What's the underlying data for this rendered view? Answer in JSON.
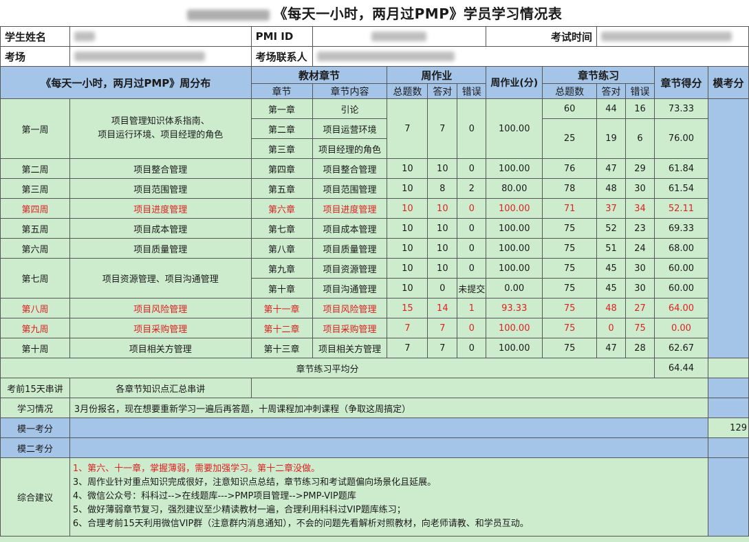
{
  "title": "《每天一小时，两月过PMP》学员学习情况表",
  "info": {
    "student_name_label": "学生姓名",
    "pmi_id_label": "PMI ID",
    "exam_time_label": "考试时间",
    "exam_site_label": "考场",
    "exam_contact_label": "考场联系人"
  },
  "headers": {
    "weekly": "《每天一小时，两月过PMP》周分布",
    "chapters": "教材章节",
    "chapter": "章节",
    "chapter_content": "章节内容",
    "homework": "周作业",
    "hw_total": "总题数",
    "hw_correct": "答对",
    "hw_wrong": "错误",
    "hw_score": "周作业(分)",
    "practice": "章节练习",
    "pr_total": "总题数",
    "pr_correct": "答对",
    "pr_wrong": "错误",
    "chapter_score": "章节得分",
    "mock_score": "模考分"
  },
  "weeks": [
    {
      "week": "第一周",
      "topic": "项目管理知识体系指南、\n项目运行环境、项目经理的角色"
    },
    {
      "week": "第二周",
      "topic": "项目整合管理"
    },
    {
      "week": "第三周",
      "topic": "项目范围管理"
    },
    {
      "week": "第四周",
      "topic": "项目进度管理"
    },
    {
      "week": "第五周",
      "topic": "项目成本管理"
    },
    {
      "week": "第六周",
      "topic": "项目质量管理"
    },
    {
      "week": "第七周",
      "topic": "项目资源管理、项目沟通管理"
    },
    {
      "week": "第八周",
      "topic": "项目风险管理"
    },
    {
      "week": "第九周",
      "topic": "项目采购管理"
    },
    {
      "week": "第十周",
      "topic": "项目相关方管理"
    }
  ],
  "chapters": [
    {
      "ch": "第一章",
      "content": "引论"
    },
    {
      "ch": "第二章",
      "content": "项目运营环境"
    },
    {
      "ch": "第三章",
      "content": "项目经理的角色"
    },
    {
      "ch": "第四章",
      "content": "项目整合管理"
    },
    {
      "ch": "第五章",
      "content": "项目范围管理"
    },
    {
      "ch": "第六章",
      "content": "项目进度管理"
    },
    {
      "ch": "第七章",
      "content": "项目成本管理"
    },
    {
      "ch": "第八章",
      "content": "项目质量管理"
    },
    {
      "ch": "第九章",
      "content": "项目资源管理"
    },
    {
      "ch": "第十章",
      "content": "项目沟通管理"
    },
    {
      "ch": "第十一章",
      "content": "项目风险管理"
    },
    {
      "ch": "第十二章",
      "content": "项目采购管理"
    },
    {
      "ch": "第十三章",
      "content": "项目相关方管理"
    }
  ],
  "homework": [
    {
      "total": "7",
      "correct": "7",
      "wrong": "0",
      "score": "100.00"
    },
    {
      "total": "10",
      "correct": "10",
      "wrong": "0",
      "score": "100.00"
    },
    {
      "total": "10",
      "correct": "8",
      "wrong": "2",
      "score": "80.00"
    },
    {
      "total": "10",
      "correct": "10",
      "wrong": "0",
      "score": "100.00"
    },
    {
      "total": "10",
      "correct": "10",
      "wrong": "0",
      "score": "100.00"
    },
    {
      "total": "10",
      "correct": "10",
      "wrong": "0",
      "score": "100.00"
    },
    {
      "total": "10",
      "correct": "10",
      "wrong": "0",
      "score": "100.00"
    },
    {
      "total": "10",
      "correct": "0",
      "wrong": "未提交",
      "score": "0.00"
    },
    {
      "total": "15",
      "correct": "14",
      "wrong": "1",
      "score": "93.33"
    },
    {
      "total": "7",
      "correct": "7",
      "wrong": "0",
      "score": "100.00"
    },
    {
      "total": "7",
      "correct": "7",
      "wrong": "0",
      "score": "100.00"
    }
  ],
  "practice": [
    {
      "total": "60",
      "correct": "44",
      "wrong": "16",
      "score": "73.33"
    },
    {
      "total": "25",
      "correct": "19",
      "wrong": "6",
      "score": "76.00"
    },
    {
      "total": "76",
      "correct": "47",
      "wrong": "29",
      "score": "61.84"
    },
    {
      "total": "78",
      "correct": "48",
      "wrong": "30",
      "score": "61.54"
    },
    {
      "total": "71",
      "correct": "37",
      "wrong": "34",
      "score": "52.11"
    },
    {
      "total": "75",
      "correct": "52",
      "wrong": "23",
      "score": "69.33"
    },
    {
      "total": "75",
      "correct": "51",
      "wrong": "24",
      "score": "68.00"
    },
    {
      "total": "75",
      "correct": "45",
      "wrong": "30",
      "score": "60.00"
    },
    {
      "total": "75",
      "correct": "45",
      "wrong": "30",
      "score": "60.00"
    },
    {
      "total": "75",
      "correct": "48",
      "wrong": "27",
      "score": "64.00"
    },
    {
      "total": "75",
      "correct": "0",
      "wrong": "75",
      "score": "0.00"
    },
    {
      "total": "75",
      "correct": "47",
      "wrong": "28",
      "score": "62.67"
    }
  ],
  "average": {
    "label": "章节练习平均分",
    "value": "64.44"
  },
  "review": {
    "label": "考前15天串讲",
    "content": "各章节知识点汇总串讲"
  },
  "study": {
    "label": "学习情况",
    "content": "3月份报名，现在想要重新学习一遍后再答题，十周课程加冲刺课程（争取这周搞定）"
  },
  "mock1": {
    "label": "模一考分",
    "value": "129"
  },
  "mock2": {
    "label": "模二考分"
  },
  "advice": {
    "label": "综合建议",
    "lines": [
      "1、第六、十一章，掌握薄弱，需要加强学习。第十二章没做。",
      "3、周作业针对重点知识完成很好，注意知识点总结，章节练习和考试题偏向场景化且延展。",
      "4、微信公众号：科科过-->在线题库--->PMP项目管理-->PMP-VIP题库",
      "5、做好薄弱章节复习，强烈建议至少精读教材一遍，合理利用科科过VIP题库练习；",
      "6、合理考前15天利用微信VIP群（注意群内消息通知），不会的问题先看解析对照教材，向老师请教、和学员互动。"
    ]
  },
  "colors": {
    "green": "#cdeccd",
    "blue": "#a4c4e8",
    "red": "#e02020"
  }
}
